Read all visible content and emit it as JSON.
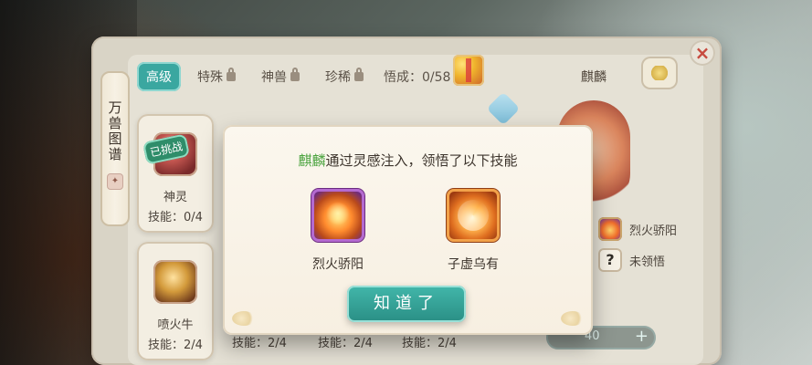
{
  "ui": {
    "side_scroll_text": "万兽图谱",
    "close_symbol": "×"
  },
  "tabs": [
    {
      "label": "高级",
      "locked": false,
      "active": true
    },
    {
      "label": "特殊",
      "locked": true,
      "active": false
    },
    {
      "label": "神兽",
      "locked": true,
      "active": false
    },
    {
      "label": "珍稀",
      "locked": true,
      "active": false
    }
  ],
  "progress": "悟成：0/58",
  "right_panel": {
    "title": "麒麟",
    "skills": [
      {
        "label": "烈火骄阳"
      },
      {
        "label": "未领悟"
      }
    ],
    "stepper_value": "40",
    "stepper_plus": "+"
  },
  "cards": [
    {
      "name": "神灵",
      "skills": "技能：0/4",
      "badge": "已挑战"
    },
    {
      "name": "喷火牛",
      "skills": "技能：2/4"
    }
  ],
  "bottom_partial": [
    "技能：2/4",
    "技能：2/4",
    "技能：2/4"
  ],
  "modal": {
    "title_highlight": "麒麟",
    "title_text": "通过灵感注入，领悟了以下技能",
    "skills": [
      {
        "label": "烈火骄阳"
      },
      {
        "label": "子虚乌有"
      }
    ],
    "ok_button": "知道了"
  }
}
